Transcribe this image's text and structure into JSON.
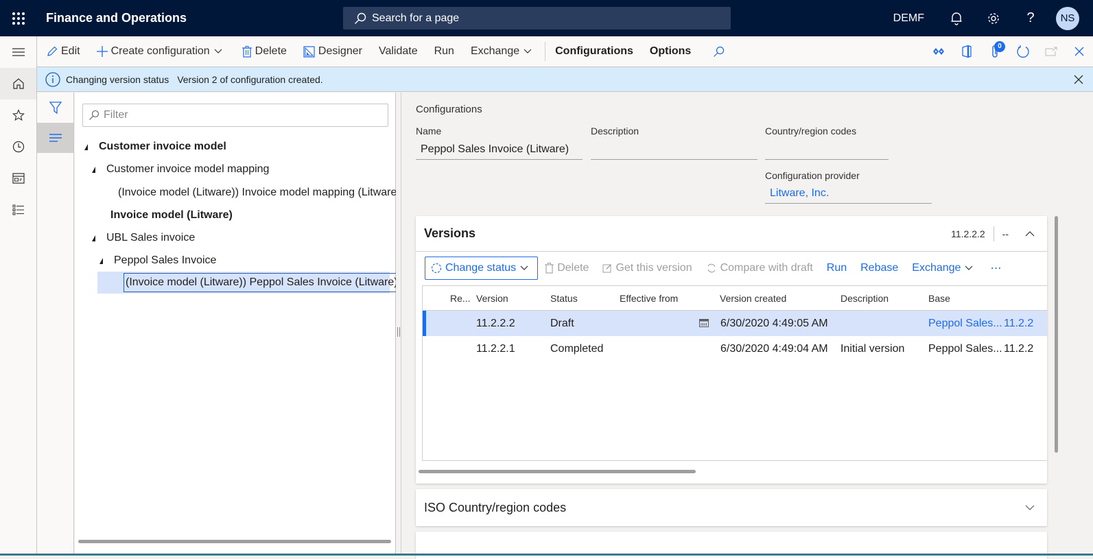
{
  "topbar": {
    "app_title": "Finance and Operations",
    "search_placeholder": "Search for a page",
    "company": "DEMF",
    "user_initials": "NS"
  },
  "actions": {
    "edit": "Edit",
    "create_configuration": "Create configuration",
    "delete": "Delete",
    "designer": "Designer",
    "validate": "Validate",
    "run": "Run",
    "exchange": "Exchange",
    "configurations": "Configurations",
    "options": "Options",
    "attachments_count": "0"
  },
  "message": {
    "title": "Changing version status",
    "text": "Version 2 of configuration created."
  },
  "tree": {
    "filter_placeholder": "Filter",
    "nodes": [
      {
        "label": "Customer invoice model",
        "level": 0,
        "expanded": true,
        "bold": true
      },
      {
        "label": "Customer invoice model mapping",
        "level": 1,
        "expanded": true,
        "bold": false
      },
      {
        "label": "(Invoice model (Litware)) Invoice model mapping (Litware)",
        "level": 2,
        "expanded": null,
        "bold": false
      },
      {
        "label": "Invoice model (Litware)",
        "level": 1,
        "expanded": null,
        "bold": true
      },
      {
        "label": "UBL Sales invoice",
        "level": 1,
        "expanded": true,
        "bold": false
      },
      {
        "label": "Peppol Sales Invoice",
        "level": 2,
        "expanded": true,
        "bold": false
      },
      {
        "label": "(Invoice model (Litware)) Peppol Sales Invoice (Litware)",
        "level": 3,
        "expanded": null,
        "bold": false,
        "selected": true
      }
    ]
  },
  "details": {
    "section_title": "Configurations",
    "name_label": "Name",
    "name_value": "Peppol Sales Invoice (Litware)",
    "description_label": "Description",
    "description_value": "",
    "country_label": "Country/region codes",
    "country_value": "",
    "provider_label": "Configuration provider",
    "provider_value": "Litware, Inc."
  },
  "versions": {
    "title": "Versions",
    "summary_version": "11.2.2.2",
    "summary_status": "--",
    "toolbar": {
      "change_status": "Change status",
      "delete": "Delete",
      "get_this_version": "Get this version",
      "compare_with_draft": "Compare with draft",
      "run": "Run",
      "rebase": "Rebase",
      "exchange": "Exchange",
      "more": "⋯"
    },
    "columns": [
      "Re...",
      "Version",
      "Status",
      "Effective from",
      "Version created",
      "Description",
      "Base"
    ],
    "rows": [
      {
        "version": "11.2.2.2",
        "status": "Draft",
        "effective_from": "",
        "created": "6/30/2020 4:49:05 AM",
        "description": "",
        "base": "Peppol Sales...",
        "base_version": "11.2.2",
        "selected": true
      },
      {
        "version": "11.2.2.1",
        "status": "Completed",
        "effective_from": "",
        "created": "6/30/2020 4:49:04 AM",
        "description": "Initial version",
        "base": "Peppol Sales...",
        "base_version": "11.2.2",
        "selected": false
      }
    ]
  },
  "iso": {
    "title": "ISO Country/region codes"
  }
}
